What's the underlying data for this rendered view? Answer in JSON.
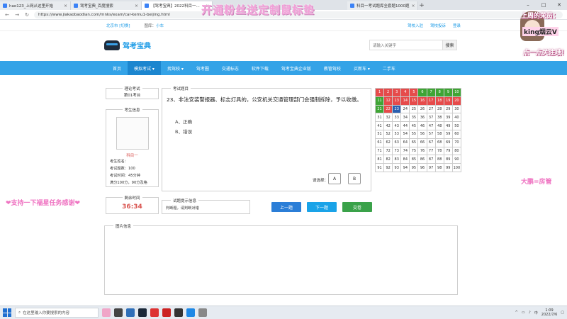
{
  "browser": {
    "tabs": [
      {
        "title": "hao123_上网从这里开始",
        "active": false
      },
      {
        "title": "驾考宝典_百度搜索",
        "active": false
      },
      {
        "title": "【驾考宝典】2022科目一...",
        "active": true
      },
      {
        "title": "科目一考试题库全套题1000题",
        "active": false
      }
    ],
    "url": "https://www.jiakaobaodian.com/mnks/exam/car-kemu1-beijing.html"
  },
  "site_top": {
    "location": "北京市 [切换]",
    "nav_label": "图库：",
    "nav_value": "小车",
    "links": [
      "驾校入驻",
      "驾校投诉",
      "登录"
    ]
  },
  "header": {
    "logo_text": "驾考宝典",
    "search_placeholder": "请输入关键字",
    "search_button": "搜索"
  },
  "main_nav": [
    {
      "label": "首页",
      "active": false
    },
    {
      "label": "模拟考试 ▾",
      "active": true
    },
    {
      "label": "找驾校 ▾",
      "active": false
    },
    {
      "label": "驾考圈",
      "active": false
    },
    {
      "label": "交通标志",
      "active": false
    },
    {
      "label": "软件下载",
      "active": false
    },
    {
      "label": "驾考宝典企业版",
      "active": false
    },
    {
      "label": "教管驾校",
      "active": false
    },
    {
      "label": "买新车 ▾",
      "active": false
    },
    {
      "label": "二手车",
      "active": false
    }
  ],
  "exam": {
    "seat": {
      "title": "理论考试",
      "value": "第01考台"
    },
    "candidate": {
      "title": "考生信息",
      "subject": "科目一",
      "rows": [
        "考生姓名：",
        "考试题数：100",
        "考试时间：45分钟",
        "满分100分，90分及格"
      ]
    },
    "question": {
      "title": "考试题目",
      "text": "23、非法安装警报器、标志灯具的，公安机关交通管理部门会强制拆除，予以收缴。",
      "options": [
        "A、正确",
        "B、错误"
      ],
      "choose_label": "请选择：",
      "choices": [
        "A",
        "B"
      ]
    },
    "timer": {
      "title": "剩余时间",
      "value": "36:34"
    },
    "hint": {
      "title": "试题提示信息",
      "text": "判断题，请判断对错"
    },
    "buttons": {
      "prev": "上一题",
      "next": "下一题",
      "submit": "交卷"
    },
    "pictures": {
      "title": "图片信息"
    },
    "answer_grid": {
      "wrong": [
        1,
        2,
        3,
        4,
        5,
        12,
        13,
        14,
        15,
        16,
        17,
        18,
        19,
        20,
        22
      ],
      "right": [
        6,
        7,
        8,
        9,
        10,
        11,
        21
      ],
      "current": 23
    }
  },
  "overlays": {
    "banner": "开通粉丝送定制鼠标垫",
    "left": "❤支持一下福星任务感谢❤",
    "right": "大鹏=房管",
    "avatar_caption_1": "上周的荣员：",
    "avatar_caption_2": "king烟云V",
    "avatar_caption_3": "点一点关注哦！"
  },
  "taskbar": {
    "search_placeholder": "在这里输入你要搜索的内容",
    "time": "1:09",
    "date": "2022/7/6",
    "lang": "中"
  }
}
